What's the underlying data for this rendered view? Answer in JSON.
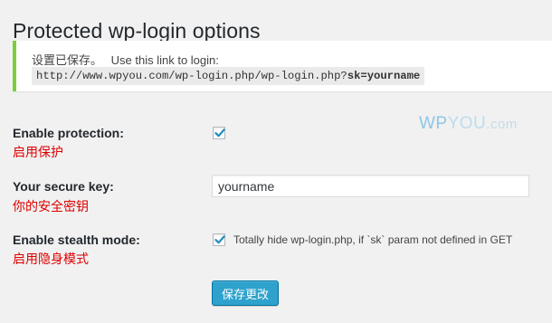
{
  "page": {
    "title": "Protected wp-login options"
  },
  "notice": {
    "saved_text": "设置已保存。",
    "link_text": "Use this link to login:",
    "url_base": "http://www.wpyou.com/wp-login.php/wp-login.php?",
    "url_param": "sk=yourname"
  },
  "watermark": {
    "wp": "WP",
    "you": "YOU",
    "com": ".com"
  },
  "fields": {
    "protection": {
      "label": "Enable protection:",
      "label_cn": "启用保护",
      "checked": true
    },
    "secure_key": {
      "label": "Your secure key:",
      "label_cn": "你的安全密钥",
      "value": "yourname"
    },
    "stealth": {
      "label": "Enable stealth mode:",
      "label_cn": "启用隐身模式",
      "checked": true,
      "description": "Totally hide wp-login.php, if `sk` param not defined in GET"
    }
  },
  "buttons": {
    "save_label": "保存更改"
  },
  "colors": {
    "notice_border": "#7ad03a",
    "accent_red": "#dd0000",
    "button_blue": "#2ea2cc"
  }
}
